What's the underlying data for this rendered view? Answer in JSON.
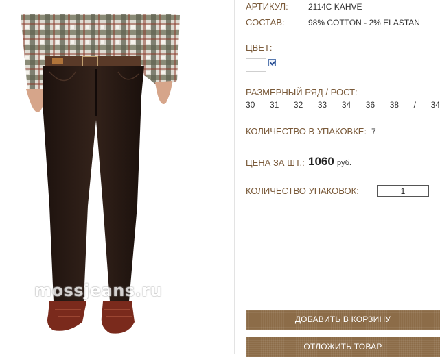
{
  "product": {
    "watermark": "mossjeans.ru",
    "article_label": "АРТИКУЛ:",
    "article_value": "2114C KAHVE",
    "composition_label": "СОСТАВ:",
    "composition_value": "98% COTTON - 2% ELASTAN",
    "color_label": "ЦВЕТ:",
    "color_swatch": "#ffffff",
    "color_checked": true,
    "size_label": "РАЗМЕРНЫЙ РЯД / РОСТ:",
    "sizes": [
      "30",
      "31",
      "32",
      "33",
      "34",
      "36",
      "38",
      "/",
      "34"
    ],
    "pack_label": "КОЛИЧЕСТВО В УПАКОВКЕ:",
    "pack_value": "7",
    "price_label": "ЦЕНА ЗА ШТ.:",
    "price_value": "1060",
    "price_currency": "руб.",
    "packs_label": "КОЛИЧЕСТВО УПАКОВОК:",
    "packs_value": "1"
  },
  "buttons": {
    "add_to_cart": "ДОБАВИТЬ В КОРЗИНУ",
    "postpone": "ОТЛОЖИТЬ ТОВАР"
  },
  "colors": {
    "label": "#7a5a3a",
    "button": "#8c6c48",
    "jeans": "#2a1a14"
  }
}
